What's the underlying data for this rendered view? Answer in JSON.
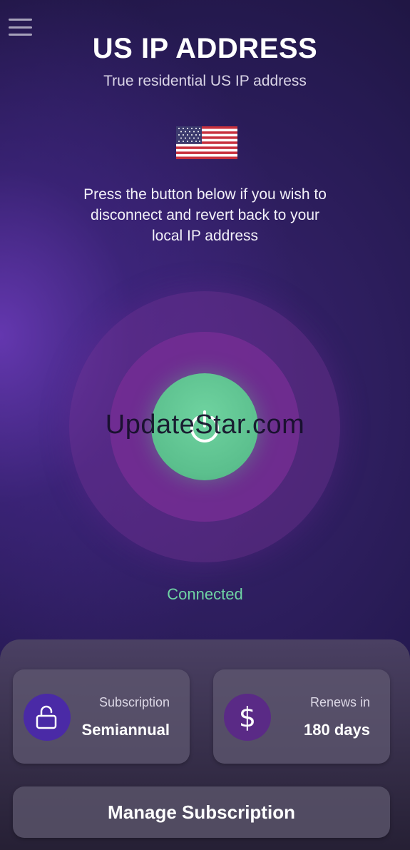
{
  "header": {
    "title": "US IP ADDRESS",
    "subtitle": "True residential US IP address",
    "flag_icon": "us-flag-icon"
  },
  "instructions": "Press the button below if you wish to disconnect and revert back to your local IP address",
  "connection": {
    "status": "Connected",
    "status_color": "#6fd3a4",
    "button_color": "#5bbf8d"
  },
  "watermark": "UpdateStar.com",
  "subscription_card": {
    "label": "Subscription",
    "value": "Semiannual",
    "icon": "unlock-icon"
  },
  "renewal_card": {
    "label": "Renews in",
    "value": "180 days",
    "icon": "dollar-icon",
    "icon_glyph": "$"
  },
  "manage_button": {
    "label": "Manage Subscription"
  },
  "colors": {
    "background": "#261a52",
    "accent_purple": "#4a2aa6",
    "accent_green": "#5bbf8d"
  }
}
